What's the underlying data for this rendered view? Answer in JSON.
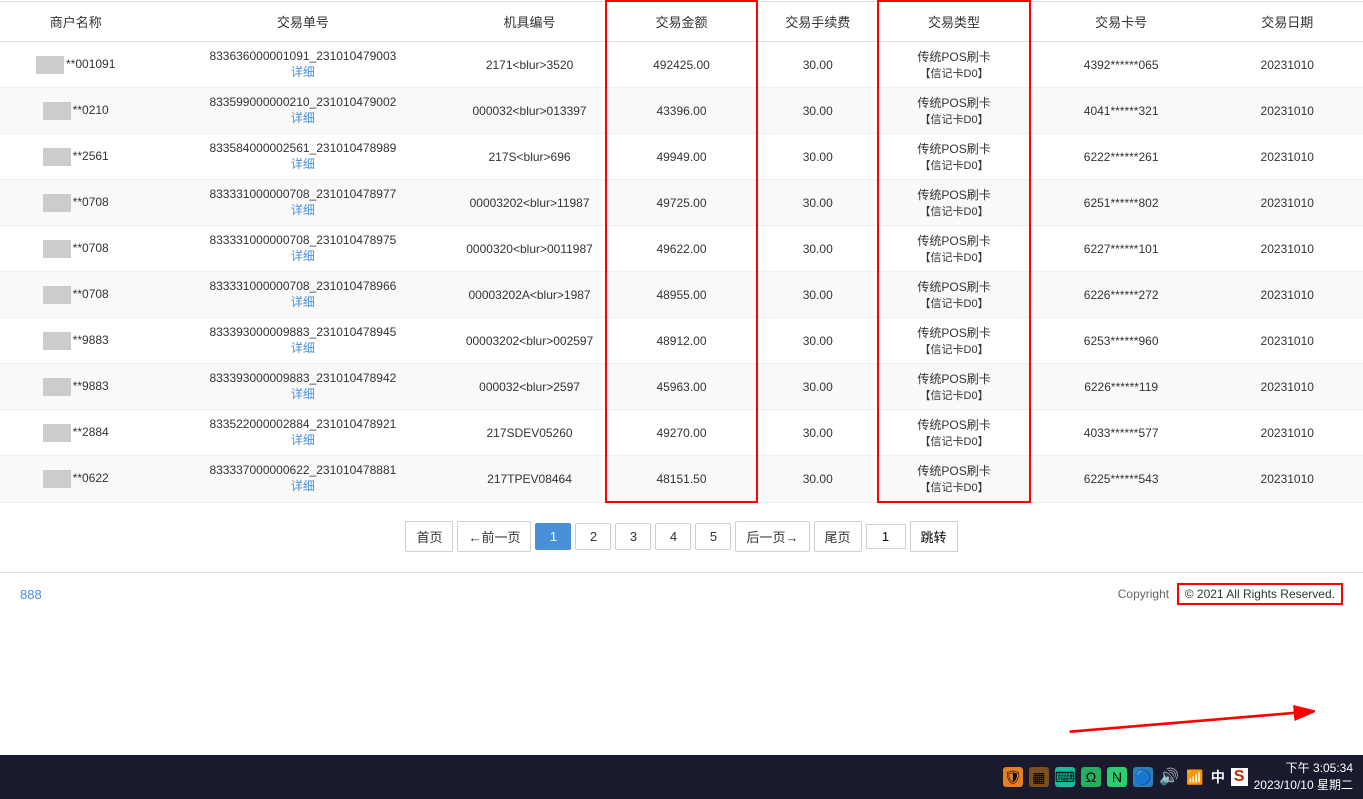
{
  "table": {
    "headers": [
      "商户名称",
      "交易单号",
      "机具编号",
      "交易金额",
      "交易手续费",
      "交易类型",
      "交易卡号",
      "交易日期"
    ],
    "rows": [
      {
        "merchant": "**001091",
        "order_no": "833636000001091_231010479003",
        "detail": "详细",
        "device": "2171<blur>3520",
        "amount": "492425.00",
        "fee": "30.00",
        "type_line1": "传统POS刷卡",
        "type_line2": "【信记卡D0】",
        "card": "4392******065",
        "date": "20231010"
      },
      {
        "merchant": "**0210",
        "order_no": "833599000000210_231010479002",
        "detail": "详细",
        "device": "000032<blur>013397",
        "amount": "43396.00",
        "fee": "30.00",
        "type_line1": "传统POS刷卡",
        "type_line2": "【信记卡D0】",
        "card": "4041******321",
        "date": "20231010"
      },
      {
        "merchant": "**2561",
        "order_no": "833584000002561_231010478989",
        "detail": "详细",
        "device": "217S<blur>696",
        "amount": "49949.00",
        "fee": "30.00",
        "type_line1": "传统POS刷卡",
        "type_line2": "【信记卡D0】",
        "card": "6222******261",
        "date": "20231010"
      },
      {
        "merchant": "**0708",
        "order_no": "833331000000708_231010478977",
        "detail": "详细",
        "device": "00003202<blur>11987",
        "amount": "49725.00",
        "fee": "30.00",
        "type_line1": "传统POS刷卡",
        "type_line2": "【信记卡D0】",
        "card": "6251******802",
        "date": "20231010"
      },
      {
        "merchant": "**0708",
        "order_no": "833331000000708_231010478975",
        "detail": "详细",
        "device": "0000320<blur>0011987",
        "amount": "49622.00",
        "fee": "30.00",
        "type_line1": "传统POS刷卡",
        "type_line2": "【信记卡D0】",
        "card": "6227******101",
        "date": "20231010"
      },
      {
        "merchant": "**0708",
        "order_no": "833331000000708_231010478966",
        "detail": "详细",
        "device": "00003202A<blur>1987",
        "amount": "48955.00",
        "fee": "30.00",
        "type_line1": "传统POS刷卡",
        "type_line2": "【信记卡D0】",
        "card": "6226******272",
        "date": "20231010"
      },
      {
        "merchant": "**9883",
        "order_no": "833393000009883_231010478945",
        "detail": "详细",
        "device": "00003202<blur>002597",
        "amount": "48912.00",
        "fee": "30.00",
        "type_line1": "传统POS刷卡",
        "type_line2": "【信记卡D0】",
        "card": "6253******960",
        "date": "20231010"
      },
      {
        "merchant": "**9883",
        "order_no": "833393000009883_231010478942",
        "detail": "详细",
        "device": "000032<blur>2597",
        "amount": "45963.00",
        "fee": "30.00",
        "type_line1": "传统POS刷卡",
        "type_line2": "【信记卡D0】",
        "card": "6226******119",
        "date": "20231010"
      },
      {
        "merchant": "**2884",
        "order_no": "833522000002884_231010478921",
        "detail": "详细",
        "device": "217SDEV05260",
        "amount": "49270.00",
        "fee": "30.00",
        "type_line1": "传统POS刷卡",
        "type_line2": "【信记卡D0】",
        "card": "4033******577",
        "date": "20231010"
      },
      {
        "merchant": "**0622",
        "order_no": "833337000000622_231010478881",
        "detail": "详细",
        "device": "217TPEV08464",
        "amount": "48151.50",
        "fee": "30.00",
        "type_line1": "传统POS刷卡",
        "type_line2": "【信记卡D0】",
        "card": "6225******543",
        "date": "20231010"
      }
    ]
  },
  "pagination": {
    "first": "首页",
    "prev": "←前一页",
    "pages": [
      "1",
      "2",
      "3",
      "4",
      "5"
    ],
    "next": "后一页→",
    "last": "尾页",
    "current": "1",
    "jump_label": "跳转"
  },
  "footer": {
    "left_number": "888",
    "copyright_left": "Copyright",
    "copyright_right": "© 2021 All Rights Reserved."
  },
  "taskbar": {
    "lang": "中",
    "time": "下午 3:05:34",
    "date": "2023/10/10 星期二"
  }
}
